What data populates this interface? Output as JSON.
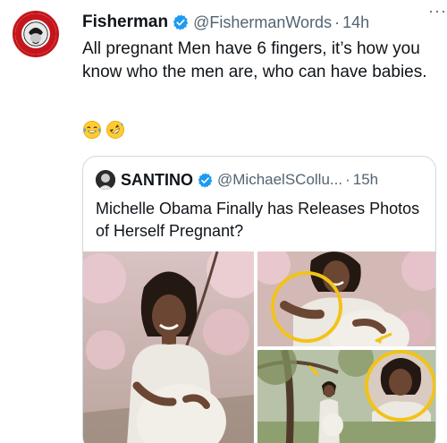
{
  "tweet": {
    "author_name": "Fisherman",
    "author_handle": "@FishermanWords",
    "separator": "·",
    "time": "14h",
    "more_label": "···",
    "text": "All pregnant Men have 6 fingers, it’s how you know who the men are, who can have babies.",
    "emojis": [
      "face-with-tears-of-joy",
      "rolling-on-floor-laughing"
    ]
  },
  "quote": {
    "author_name": "SANTINO",
    "author_handle": "@MichaelSCollu...",
    "separator": "·",
    "time": "15h",
    "text": "Michelle Obama Finally has Releases Photos of Herself Pregnant?"
  },
  "colors": {
    "verified": "#1d9bf0",
    "secondary_text": "#536471",
    "border": "#cfd9de",
    "highlight_circle": "#f2c318"
  },
  "icons": {
    "verified": "verified-badge-icon",
    "more": "more-icon"
  }
}
